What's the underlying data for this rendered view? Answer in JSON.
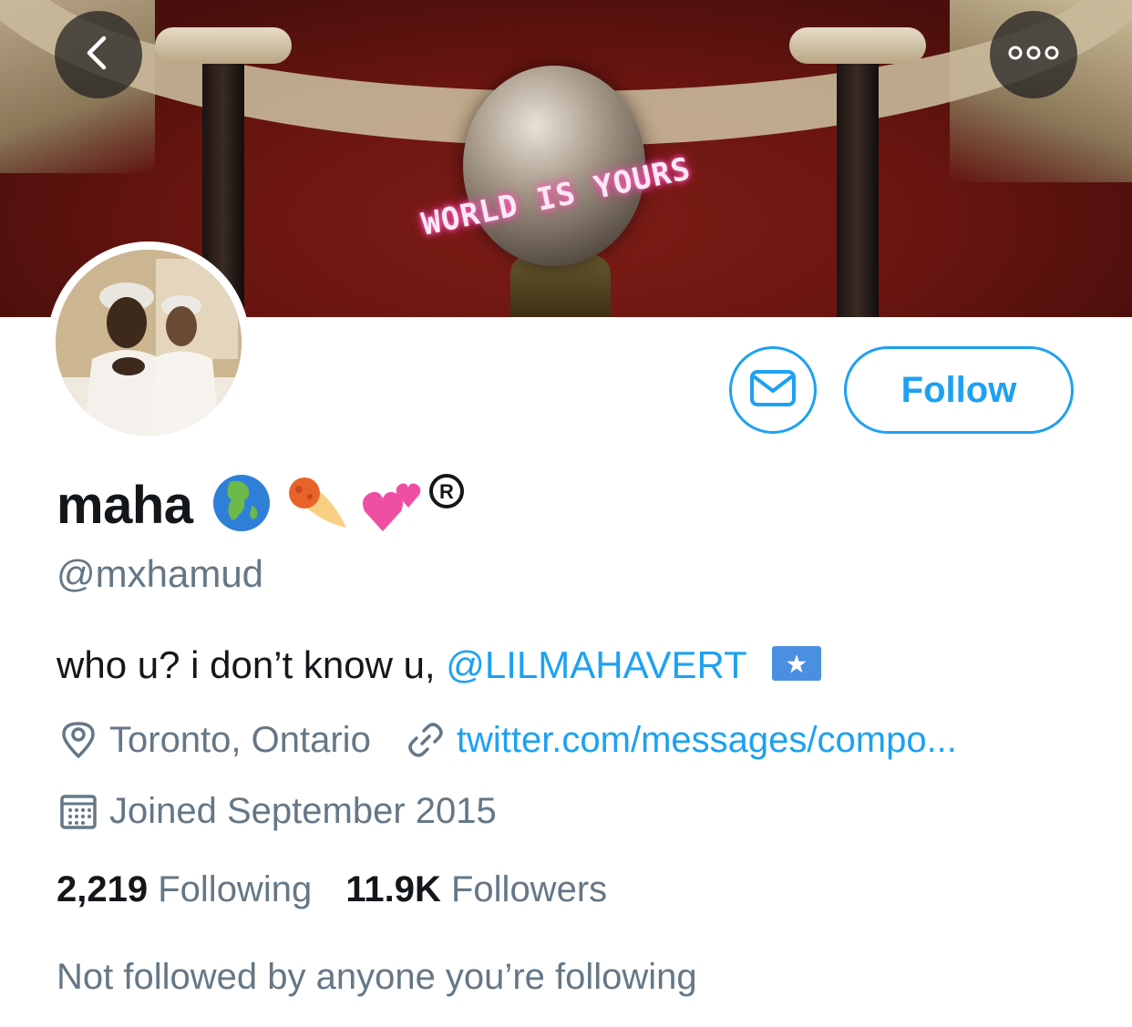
{
  "banner": {
    "neon_text": "WORLD IS YOURS",
    "icons": {
      "back": "chevron-left-icon",
      "more": "more-dots-icon"
    }
  },
  "actions": {
    "message_icon": "envelope-icon",
    "follow_label": "Follow",
    "accent_color": "#1da1f2"
  },
  "profile": {
    "display_name": "maha",
    "name_emoji": [
      "🌍",
      "☄️",
      "💕",
      "®"
    ],
    "handle": "@mxhamud",
    "bio_text": "who u? i don’t know u, ",
    "bio_mention": "@LILMAHAVERT",
    "bio_flag": "🇸🇴",
    "location": "Toronto, Ontario",
    "website": "twitter.com/messages/compo...",
    "joined": "Joined September 2015"
  },
  "stats": {
    "following_count": "2,219",
    "following_label": "Following",
    "followers_count": "11.9K",
    "followers_label": "Followers"
  },
  "followed_by_text": "Not followed by anyone you’re following",
  "colors": {
    "text_primary": "#14171a",
    "text_secondary": "#657786"
  }
}
